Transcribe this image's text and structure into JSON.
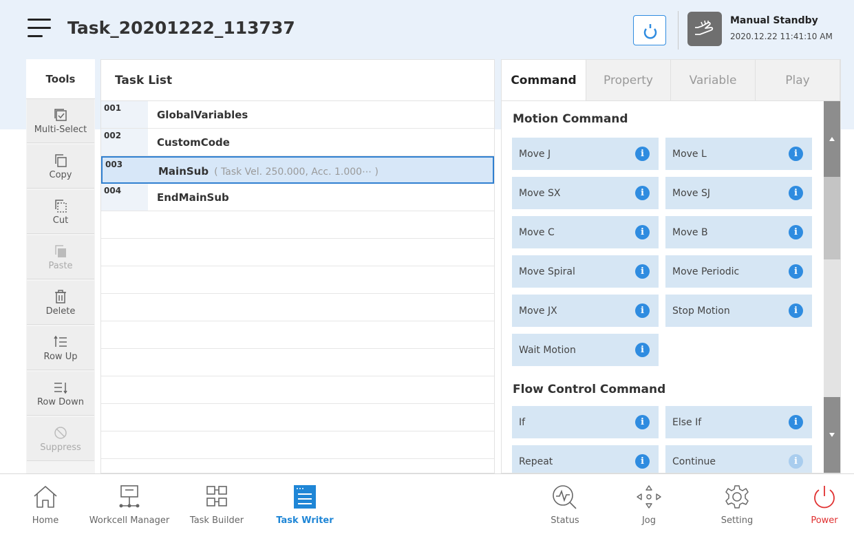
{
  "header": {
    "title": "Task_20201222_113737",
    "mode_title": "Manual Standby",
    "mode_time": "2020.12.22 11:41:10 AM"
  },
  "tools": {
    "title": "Tools",
    "items": [
      {
        "label": "Multi-Select",
        "icon": "multi-select-icon",
        "enabled": true
      },
      {
        "label": "Copy",
        "icon": "copy-icon",
        "enabled": true
      },
      {
        "label": "Cut",
        "icon": "cut-icon",
        "enabled": true
      },
      {
        "label": "Paste",
        "icon": "paste-icon",
        "enabled": false
      },
      {
        "label": "Delete",
        "icon": "delete-icon",
        "enabled": true
      },
      {
        "label": "Row Up",
        "icon": "row-up-icon",
        "enabled": true
      },
      {
        "label": "Row Down",
        "icon": "row-down-icon",
        "enabled": true
      },
      {
        "label": "Suppress",
        "icon": "suppress-icon",
        "enabled": false
      }
    ]
  },
  "task_list": {
    "title": "Task List",
    "rows": [
      {
        "num": "001",
        "name": "GlobalVariables",
        "hint": ""
      },
      {
        "num": "002",
        "name": "CustomCode",
        "hint": ""
      },
      {
        "num": "003",
        "name": "MainSub",
        "hint": "( Task Vel. 250.000, Acc. 1.000⋯ )"
      },
      {
        "num": "004",
        "name": "EndMainSub",
        "hint": ""
      }
    ],
    "selected_row": "003"
  },
  "command_panel": {
    "tabs": [
      "Command",
      "Property",
      "Variable",
      "Play"
    ],
    "active_tab": "Command",
    "motion_title": "Motion Command",
    "motion_commands": [
      "Move J",
      "Move L",
      "Move SX",
      "Move SJ",
      "Move C",
      "Move B",
      "Move Spiral",
      "Move Periodic",
      "Move JX",
      "Stop Motion",
      "Wait Motion"
    ],
    "flow_title": "Flow Control Command",
    "flow_commands": [
      "If",
      "Else If",
      "Repeat",
      "Continue"
    ],
    "info_glyph": "i"
  },
  "bottom_nav": {
    "items": [
      "Home",
      "Workcell Manager",
      "Task Builder",
      "Task Writer",
      "Status",
      "Jog",
      "Setting",
      "Power"
    ],
    "active": "Task Writer"
  },
  "colors": {
    "accent": "#2f8ce0",
    "active_nav": "#1f86d6",
    "power": "#e03030",
    "header_bg": "#e9f1fa",
    "command_button_bg": "#d6e6f4"
  }
}
